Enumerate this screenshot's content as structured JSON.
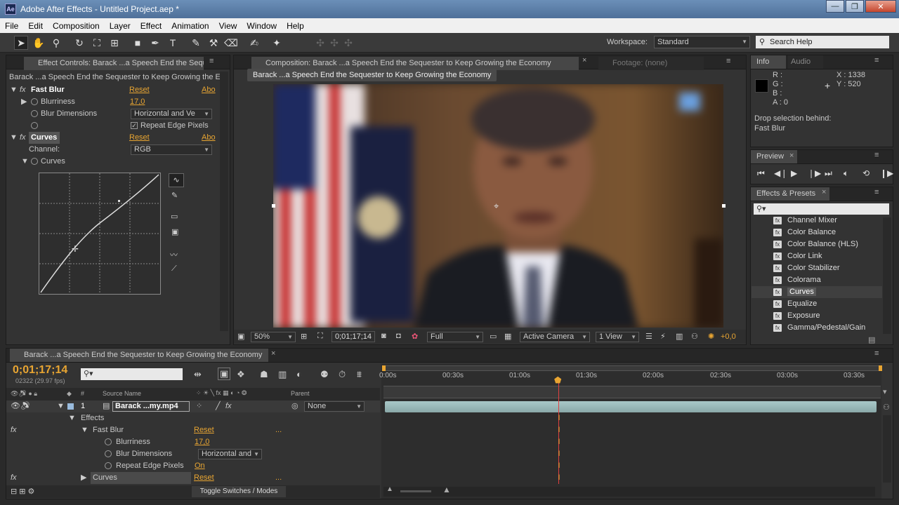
{
  "window": {
    "app_badge": "Ae",
    "title": "Adobe After Effects - Untitled Project.aep *"
  },
  "menu": [
    "File",
    "Edit",
    "Composition",
    "Layer",
    "Effect",
    "Animation",
    "View",
    "Window",
    "Help"
  ],
  "toolbar": {
    "workspace_label": "Workspace:",
    "workspace_value": "Standard",
    "search_placeholder": "Search Help"
  },
  "effect_controls": {
    "tab": "Effect Controls: Barack ...a Speech End the Seque",
    "layer_name": "Barack ...a Speech End the Sequester to Keep Growing the Ec",
    "fast_blur": {
      "name": "Fast Blur",
      "reset": "Reset",
      "about": "Abo",
      "blurriness_label": "Blurriness",
      "blurriness_value": "17,0",
      "dimensions_label": "Blur Dimensions",
      "dimensions_value": "Horizontal and Ve",
      "repeat_label": "Repeat Edge Pixels"
    },
    "curves": {
      "name": "Curves",
      "reset": "Reset",
      "about": "Abo",
      "channel_label": "Channel:",
      "channel_value": "RGB",
      "curves_label": "Curves"
    }
  },
  "composition": {
    "tab": "Composition: Barack ...a Speech End the Sequester to Keep Growing the Economy",
    "footage_tab": "Footage: (none)",
    "name_tag": "Barack ...a Speech End the Sequester to Keep Growing the Economy",
    "zoom": "50%",
    "timecode": "0;01;17;14",
    "resolution": "Full",
    "camera": "Active Camera",
    "view": "1 View",
    "exposure": "+0,0"
  },
  "info": {
    "tab_info": "Info",
    "tab_audio": "Audio",
    "r": "R :",
    "g": "G :",
    "b": "B :",
    "a": "A : 0",
    "x": "X : 1338",
    "y": "Y : 520",
    "drop_label": "Drop selection behind:",
    "drop_value": "Fast Blur"
  },
  "preview": {
    "tab": "Preview"
  },
  "effects_presets": {
    "tab": "Effects & Presets",
    "items": [
      "Channel Mixer",
      "Color Balance",
      "Color Balance (HLS)",
      "Color Link",
      "Color Stabilizer",
      "Colorama",
      "Curves",
      "Equalize",
      "Exposure",
      "Gamma/Pedestal/Gain"
    ],
    "selected": "Curves"
  },
  "timeline": {
    "tab": "Barack ...a Speech End the Sequester to Keep Growing the Economy",
    "timecode": "0;01;17;14",
    "frames": "02322 (29.97 fps)",
    "col_num": "#",
    "col_source": "Source Name",
    "col_parent": "Parent",
    "layer_num": "1",
    "layer_name": "Barack ...my.mp4",
    "parent_value": "None",
    "effects_label": "Effects",
    "fast_blur_label": "Fast Blur",
    "fast_blur_reset": "Reset",
    "dots": "...",
    "blurriness_label": "Blurriness",
    "blurriness_value": "17,0",
    "dimensions_label": "Blur Dimensions",
    "dimensions_value": "Horizontal and",
    "repeat_label": "Repeat Edge Pixels",
    "repeat_value": "On",
    "curves_label": "Curves",
    "curves_reset": "Reset",
    "toggle": "Toggle Switches / Modes",
    "ruler": [
      "0:00s",
      "00:30s",
      "01:00s",
      "01:30s",
      "02:00s",
      "02:30s",
      "03:00s",
      "03:30s"
    ],
    "fx": "fx"
  }
}
